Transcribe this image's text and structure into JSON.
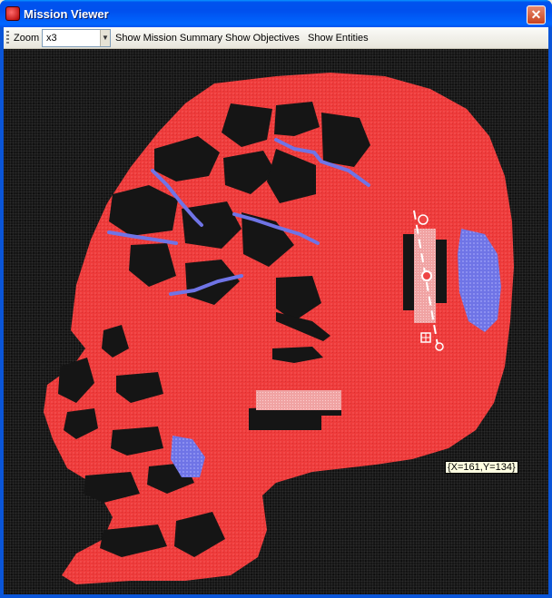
{
  "window": {
    "title": "Mission Viewer",
    "close_glyph": "✕"
  },
  "toolbar": {
    "zoom_label": "Zoom",
    "zoom_value": "x3",
    "zoom_options_arrow": "▼",
    "show_summary": "Show Mission Summary",
    "show_objectives": "Show Objectives",
    "show_entities": "Show Entities"
  },
  "viewer": {
    "cursor_coordinates": "{X=161,Y=134}"
  },
  "colors": {
    "terrain": "#ee3b3b",
    "water": "#6f74e6",
    "background": "#151515",
    "platform": "#f0a3a3"
  }
}
